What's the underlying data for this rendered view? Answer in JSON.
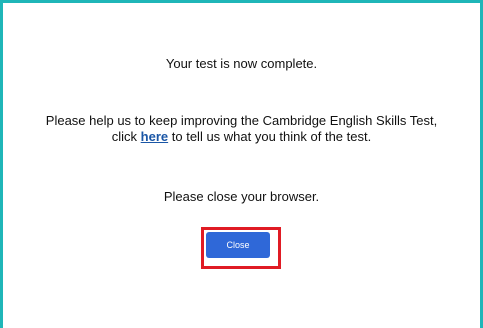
{
  "message": {
    "complete": "Your test is now complete.",
    "help_prefix": "Please help us to keep improving the Cambridge English Skills Test,",
    "help_click": "click",
    "help_link": "here",
    "help_suffix": "to tell us what you think of the test.",
    "close_browser": "Please close your browser."
  },
  "actions": {
    "close_label": "Close"
  },
  "colors": {
    "frame_accent": "#1fb6b8",
    "link": "#1a56a6",
    "button": "#2f68d8",
    "highlight": "#e01b24"
  }
}
